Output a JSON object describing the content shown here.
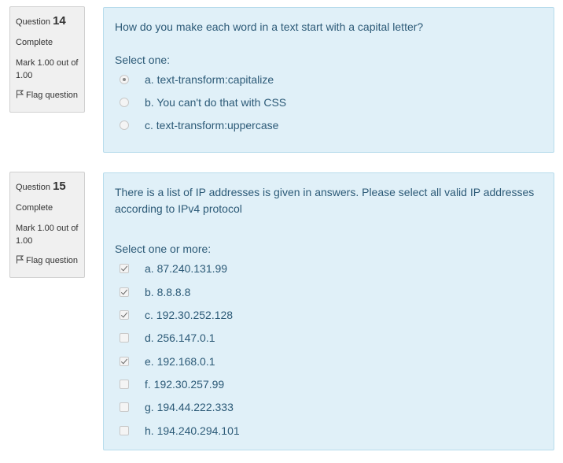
{
  "questions": [
    {
      "label": "Question",
      "number": "14",
      "state": "Complete",
      "grade": "Mark 1.00 out of 1.00",
      "flag": "Flag question",
      "text": "How do you make each word in a text start with a capital letter?",
      "prompt": "Select one:",
      "options": [
        {
          "label": "a. text-transform:capitalize",
          "selected": true
        },
        {
          "label": "b. You can't do that with CSS",
          "selected": false
        },
        {
          "label": "c. text-transform:uppercase",
          "selected": false
        }
      ]
    },
    {
      "label": "Question",
      "number": "15",
      "state": "Complete",
      "grade": "Mark 1.00 out of 1.00",
      "flag": "Flag question",
      "text": "There is a list of IP addresses is given in answers. Please select all valid IP addresses according to IPv4 protocol",
      "prompt": "Select one or more:",
      "options": [
        {
          "label": "a. 87.240.131.99",
          "selected": true
        },
        {
          "label": "b. 8.8.8.8",
          "selected": true
        },
        {
          "label": "c. 192.30.252.128",
          "selected": true
        },
        {
          "label": "d. 256.147.0.1",
          "selected": false
        },
        {
          "label": "e. 192.168.0.1",
          "selected": true
        },
        {
          "label": "f. 192.30.257.99",
          "selected": false
        },
        {
          "label": "g. 194.44.222.333",
          "selected": false
        },
        {
          "label": "h. 194.240.294.101",
          "selected": false
        }
      ]
    }
  ]
}
